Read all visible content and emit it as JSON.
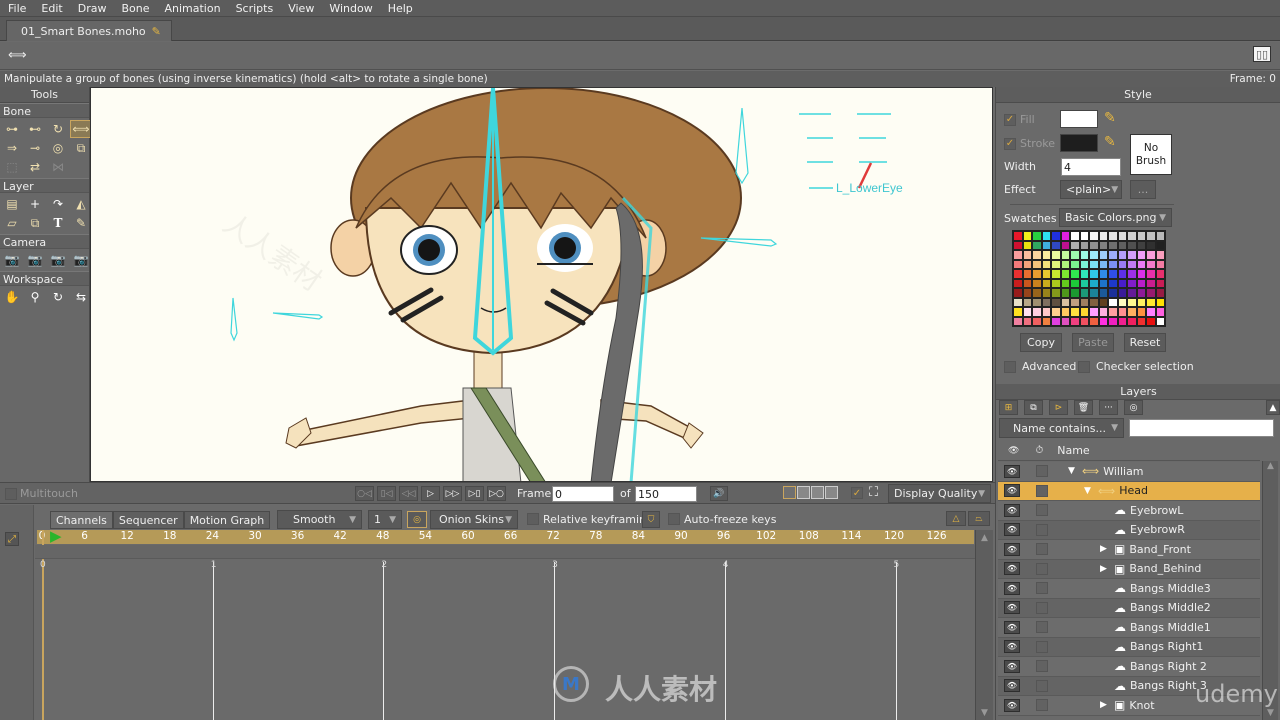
{
  "menu": [
    "File",
    "Edit",
    "Draw",
    "Bone",
    "Animation",
    "Scripts",
    "View",
    "Window",
    "Help"
  ],
  "document_tab": {
    "label": "01_Smart Bones.moho",
    "modified_icon": "pencil-icon"
  },
  "status": {
    "hint": "Manipulate a group of bones (using inverse kinematics) (hold <alt> to rotate a single bone)",
    "frame_label": "Frame: 0"
  },
  "tools": {
    "title": "Tools",
    "sections": [
      {
        "label": "Bone",
        "items": [
          "select-bone",
          "translate-bone",
          "add-bone",
          "manipulate-bones",
          "bone-strength",
          "reparent-bone",
          "bind-layer",
          "bind-points",
          "offset-bone",
          "transform-bone",
          "bone-physics"
        ]
      },
      {
        "label": "Layer",
        "items": [
          "transform-layer",
          "set-origin",
          "rotate-layer-xy",
          "shear-layer",
          "flip-layer",
          "switch-layer",
          "insert-text",
          "eyedropper"
        ]
      },
      {
        "label": "Camera",
        "items": [
          "track-camera",
          "zoom-camera",
          "roll-camera",
          "pan-tilt-camera"
        ]
      },
      {
        "label": "Workspace",
        "items": [
          "pan-workspace",
          "zoom-workspace",
          "rotate-workspace",
          "orbit-workspace"
        ]
      }
    ]
  },
  "canvas": {
    "bone_label": "L_LowerEye",
    "background": "#fefdf4"
  },
  "style_panel": {
    "title": "Style",
    "fill_label": "Fill",
    "fill_checked": true,
    "fill_color": "#ffffff",
    "stroke_label": "Stroke",
    "stroke_checked": true,
    "stroke_color": "#1e1e1e",
    "width_label": "Width",
    "width_value": "4",
    "brush_label": "No Brush",
    "effect_label": "Effect",
    "effect_value": "<plain>",
    "effect_more": "...",
    "swatches_label": "Swatches",
    "swatches_value": "Basic Colors.png",
    "copy": "Copy",
    "paste": "Paste",
    "reset": "Reset",
    "advanced": "Advanced",
    "checker": "Checker selection"
  },
  "layers_panel": {
    "title": "Layers",
    "filter_value": "Name contains...",
    "filter_text": "",
    "col_name": "Name",
    "layers": [
      {
        "name": "William",
        "type": "bone",
        "indent": 0,
        "expanded": true,
        "selected": false
      },
      {
        "name": "Head",
        "type": "bone",
        "indent": 1,
        "expanded": true,
        "selected": true
      },
      {
        "name": "EyebrowL",
        "type": "vector",
        "indent": 2,
        "selected": false
      },
      {
        "name": "EyebrowR",
        "type": "vector",
        "indent": 2,
        "selected": false
      },
      {
        "name": "Band_Front",
        "type": "group",
        "indent": 2,
        "collapsed": true,
        "selected": false
      },
      {
        "name": "Band_Behind",
        "type": "group",
        "indent": 2,
        "collapsed": true,
        "selected": false
      },
      {
        "name": "Bangs Middle3",
        "type": "vector",
        "indent": 2,
        "selected": false
      },
      {
        "name": "Bangs Middle2",
        "type": "vector",
        "indent": 2,
        "selected": false
      },
      {
        "name": "Bangs Middle1",
        "type": "vector",
        "indent": 2,
        "selected": false
      },
      {
        "name": "Bangs Right1",
        "type": "vector",
        "indent": 2,
        "selected": false
      },
      {
        "name": "Bangs Right 2",
        "type": "vector",
        "indent": 2,
        "selected": false
      },
      {
        "name": "Bangs Right 3",
        "type": "vector",
        "indent": 2,
        "selected": false
      },
      {
        "name": "Knot",
        "type": "group",
        "indent": 2,
        "collapsed": true,
        "selected": false
      }
    ]
  },
  "playback": {
    "multitouch": "Multitouch",
    "frame_label": "Frame",
    "frame_value": "0",
    "of_label": "of",
    "total_frames": "150",
    "display_quality": "Display Quality"
  },
  "timeline": {
    "tabs": [
      "Channels",
      "Sequencer",
      "Motion Graph"
    ],
    "interpolation": "Smooth",
    "interval": "1",
    "onion_skins": "Onion Skins",
    "relative_keyframing": "Relative keyframing",
    "auto_freeze": "Auto-freeze keys",
    "ruler_ticks": [
      "0",
      "6",
      "12",
      "18",
      "24",
      "30",
      "36",
      "42",
      "48",
      "54",
      "60",
      "66",
      "72",
      "78",
      "84",
      "90",
      "96",
      "102",
      "108",
      "114",
      "120",
      "126"
    ],
    "seconds": [
      "0",
      "1",
      "2",
      "3",
      "4",
      "5"
    ]
  },
  "watermarks": {
    "brand": "人人素材",
    "udemy": "udemy"
  }
}
